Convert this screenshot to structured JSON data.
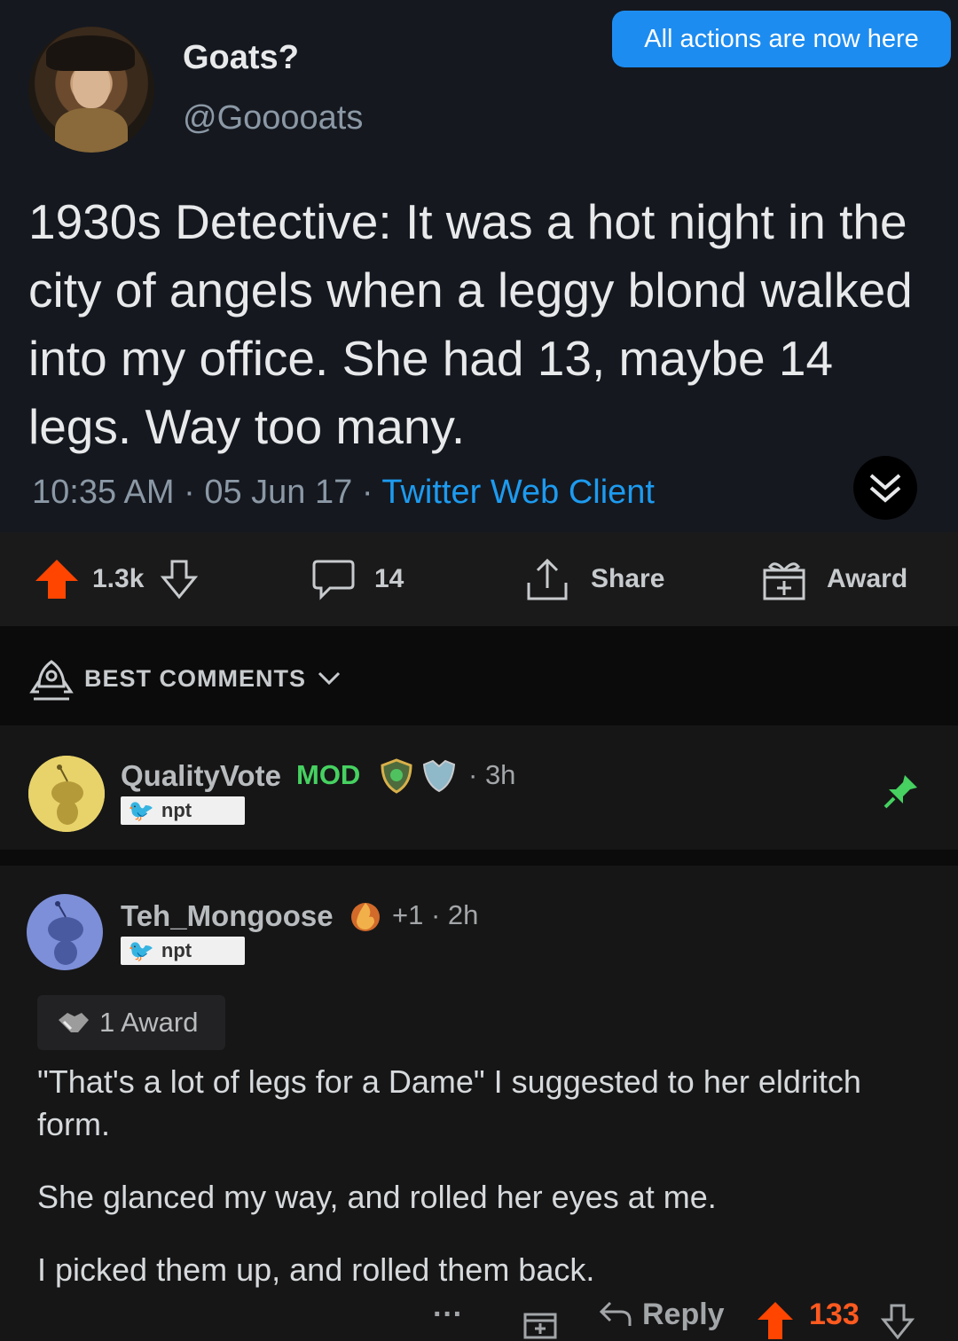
{
  "banner": {
    "text": "All actions are now here"
  },
  "tweet": {
    "name": "Goats?",
    "handle": "@Gooooats",
    "text": "1930s Detective: It was a hot night in the city of angels when a leggy blond walked into my office. She had 13, maybe 14 legs. Way too many.",
    "time": "10:35 AM",
    "date": "05 Jun 17",
    "client": "Twitter Web Client",
    "separator": " · "
  },
  "post_actions": {
    "upvotes": "1.3k",
    "comments": "14",
    "share": "Share",
    "award": "Award",
    "upvote_color": "#ff4500"
  },
  "sort": {
    "label": "BEST COMMENTS"
  },
  "comments": [
    {
      "author": "QualityVote",
      "mod": "MOD",
      "age": "3h",
      "flair": "npt",
      "pinned": true
    },
    {
      "author": "Teh_Mongoose",
      "score_delta": "+1",
      "age": "2h",
      "flair": "npt",
      "awards": "1 Award",
      "body": [
        "\"That's a lot of legs for a Dame\" I suggested to her eldritch form.",
        "She glanced my way, and rolled her eyes at me.",
        "I picked them up, and rolled them back."
      ],
      "actions": {
        "more": "···",
        "reply": "Reply",
        "score": "133"
      }
    }
  ],
  "colors": {
    "accent_blue": "#1d8cf0",
    "mod_green": "#46d160",
    "upvote_orange": "#ff4500",
    "pin_green": "#46d160"
  }
}
